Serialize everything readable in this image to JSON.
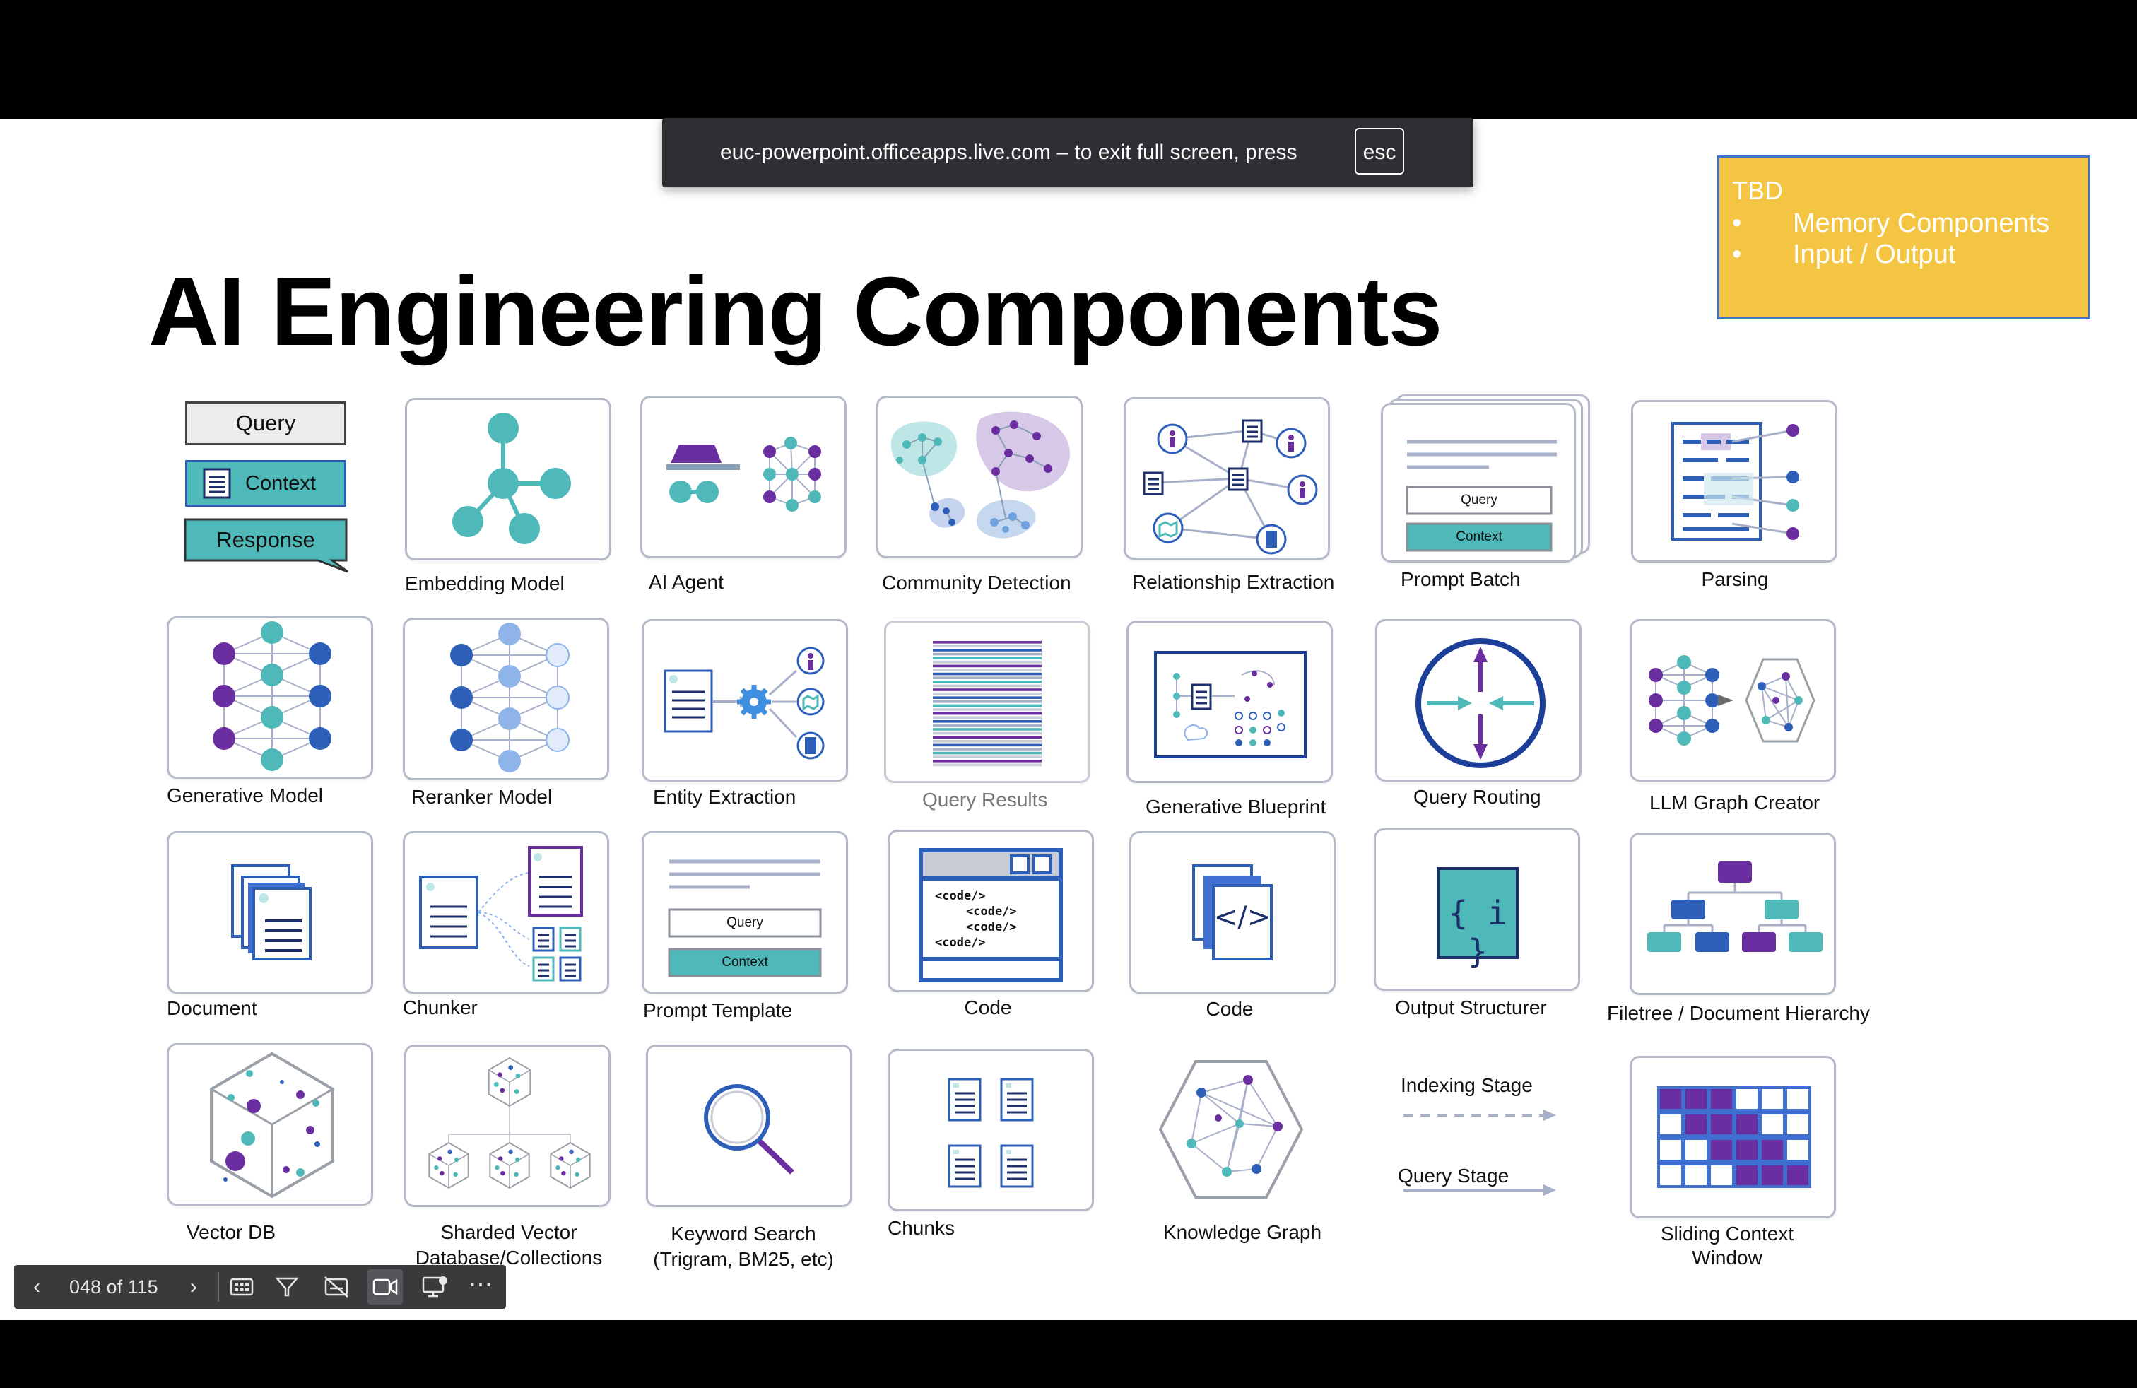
{
  "browser_banner": {
    "message": "euc-powerpoint.officeapps.live.com – to exit full screen, press",
    "key": "esc"
  },
  "slide": {
    "title": "AI Engineering Components",
    "note": {
      "heading": "TBD",
      "items": [
        "Memory Components",
        "Input / Output"
      ]
    },
    "legend_boxes": {
      "query": "Query",
      "context": "Context",
      "response": "Response"
    },
    "components": {
      "embedding_model": "Embedding Model",
      "ai_agent": "AI Agent",
      "community_detection": "Community Detection",
      "relationship_extraction": "Relationship Extraction",
      "prompt_batch": "Prompt  Batch",
      "parsing": "Parsing",
      "generative_model": "Generative Model",
      "reranker_model": "Reranker Model",
      "entity_extraction": "Entity Extraction",
      "query_results": "Query Results",
      "generative_blueprint": "Generative Blueprint",
      "query_routing": "Query Routing",
      "llm_graph_creator": "LLM Graph Creator",
      "document": "Document",
      "chunker": "Chunker",
      "prompt_template": "Prompt Template",
      "code_1": "Code",
      "code_2": "Code",
      "output_structurer": "Output Structurer",
      "filetree": "Filetree / Document Hierarchy",
      "vector_db": "Vector DB",
      "sharded_vector_1": "Sharded Vector",
      "sharded_vector_2": "Database/Collections",
      "keyword_search_1": "Keyword Search",
      "keyword_search_2": "(Trigram, BM25, etc)",
      "chunks": "Chunks",
      "knowledge_graph": "Knowledge Graph",
      "indexing_stage": "Indexing Stage",
      "query_stage": "Query Stage",
      "sliding_window_1": "Sliding Context",
      "sliding_window_2": "Window"
    },
    "tile_text": {
      "query": "Query",
      "context": "Context",
      "code_lines": [
        "<code/>",
        "<code/>",
        "<code/>",
        "<code/>"
      ],
      "code_symbol": "</>",
      "structurer_symbol": "{ i }"
    }
  },
  "nav": {
    "slide_counter": "048 of 115",
    "prev_icon": "chevron-left-icon",
    "next_icon": "chevron-right-icon",
    "tools": [
      "slide-grid-icon",
      "pen-icon",
      "subtitles-off-icon",
      "camera-icon",
      "presenter-view-icon",
      "more-icon"
    ]
  },
  "colors": {
    "teal": "#4fb8b8",
    "purple": "#6a2ea0",
    "blue": "#2e5fb8",
    "light_blue": "#8eb4ea",
    "note_yellow": "#f4c542",
    "tile_border": "#b4bac8"
  }
}
